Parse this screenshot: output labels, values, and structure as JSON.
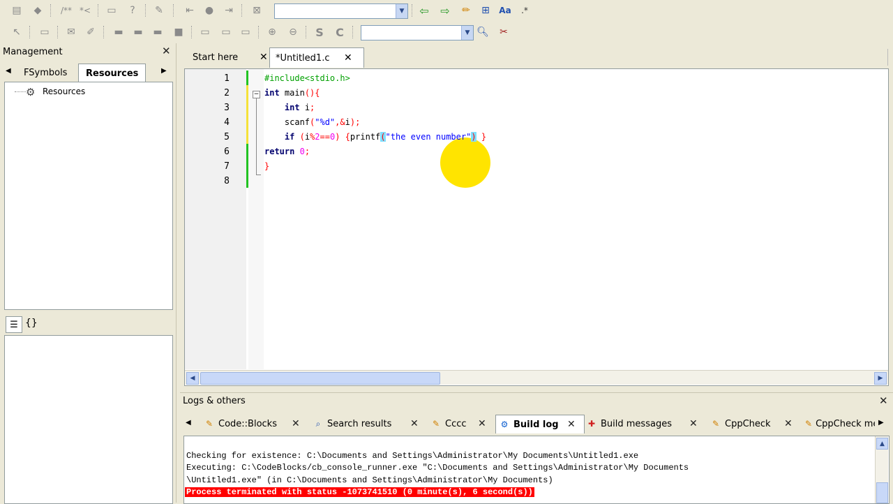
{
  "toolbar": {
    "combo1_value": "",
    "combo2_value": ""
  },
  "management": {
    "title": "Management",
    "tabs": [
      "FSymbols",
      "Resources"
    ],
    "tree_root": "Resources",
    "bottom_tabs": [
      "{}"
    ]
  },
  "editor": {
    "tabs": [
      {
        "label": "Start here"
      },
      {
        "label": "*Untitled1.c"
      }
    ],
    "line_numbers": [
      "1",
      "2",
      "3",
      "4",
      "5",
      "6",
      "7",
      "8"
    ],
    "lines": [
      "#include<stdio.h>",
      "int main(){",
      "    int i;",
      "    scanf(\"%d\",&i);",
      "    if (i%2==0) {printf(\"the even number\") }",
      "return 0;",
      "}",
      ""
    ]
  },
  "logs": {
    "title": "Logs & others",
    "tabs": [
      "Code::Blocks",
      "Search results",
      "Cccc",
      "Build log",
      "Build messages",
      "CppCheck",
      "CppCheck me"
    ],
    "active_tab": "Build log",
    "lines": [
      "Checking for existence: C:\\Documents and Settings\\Administrator\\My Documents\\Untitled1.exe",
      "Executing: C:\\CodeBlocks/cb_console_runner.exe \"C:\\Documents and Settings\\Administrator\\My Documents",
      "\\Untitled1.exe\" (in C:\\Documents and Settings\\Administrator\\My Documents)"
    ],
    "error_line": "Process terminated with status -1073741510 (0 minute(s), 6 second(s))"
  },
  "colors": {
    "error_bg": "#ff0000",
    "cursor_highlight": "#ffe400",
    "change_bar_green": "#22c322",
    "change_bar_yellow": "#f5e23a"
  }
}
